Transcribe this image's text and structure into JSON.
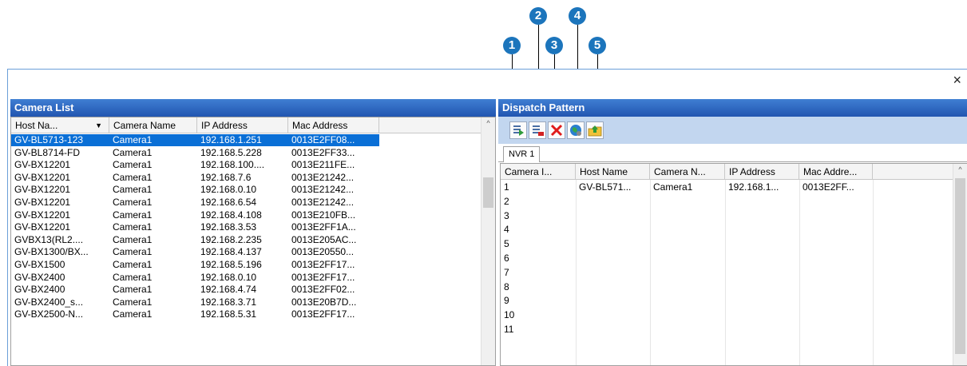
{
  "callouts": [
    "1",
    "2",
    "3",
    "4",
    "5"
  ],
  "window": {
    "close_glyph": "×"
  },
  "camera_list": {
    "title": "Camera List",
    "columns": [
      "Host Na...",
      "Camera Name",
      "IP Address",
      "Mac Address"
    ],
    "sort_glyph": "▼",
    "rows": [
      [
        "GV-BL5713-123",
        "Camera1",
        "192.168.1.251",
        "0013E2FF08..."
      ],
      [
        "GV-BL8714-FD",
        "Camera1",
        "192.168.5.228",
        "0013E2FF33..."
      ],
      [
        "GV-BX12201",
        "Camera1",
        "192.168.100....",
        "0013E211FE..."
      ],
      [
        "GV-BX12201",
        "Camera1",
        "192.168.7.6",
        "0013E21242..."
      ],
      [
        "GV-BX12201",
        "Camera1",
        "192.168.0.10",
        "0013E21242..."
      ],
      [
        "GV-BX12201",
        "Camera1",
        "192.168.6.54",
        "0013E21242..."
      ],
      [
        "GV-BX12201",
        "Camera1",
        "192.168.4.108",
        "0013E210FB..."
      ],
      [
        "GV-BX12201",
        "Camera1",
        "192.168.3.53",
        "0013E2FF1A..."
      ],
      [
        "GVBX13(RL2....",
        "Camera1",
        "192.168.2.235",
        "0013E205AC..."
      ],
      [
        "GV-BX1300/BX...",
        "Camera1",
        "192.168.4.137",
        "0013E20550..."
      ],
      [
        "GV-BX1500",
        "Camera1",
        "192.168.5.196",
        "0013E2FF17..."
      ],
      [
        "GV-BX2400",
        "Camera1",
        "192.168.0.10",
        "0013E2FF17..."
      ],
      [
        "GV-BX2400",
        "Camera1",
        "192.168.4.74",
        "0013E2FF02..."
      ],
      [
        "GV-BX2400_s...",
        "Camera1",
        "192.168.3.71",
        "0013E20B7D..."
      ],
      [
        "GV-BX2500-N...",
        "Camera1",
        "192.168.5.31",
        "0013E2FF17..."
      ]
    ],
    "selected_row": 0,
    "scroll_up_glyph": "^"
  },
  "dispatch_pattern": {
    "title": "Dispatch Pattern",
    "toolbar": [
      "add-camera-icon",
      "remove-camera-icon",
      "delete-icon",
      "network-globe-icon",
      "export-folder-icon"
    ],
    "tab": "NVR 1",
    "columns": [
      "Camera I...",
      "Host Name",
      "Camera N...",
      "IP Address",
      "Mac Addre..."
    ],
    "rows": [
      [
        "1",
        "GV-BL571...",
        "Camera1",
        "192.168.1...",
        "0013E2FF..."
      ],
      [
        "2",
        "",
        "",
        "",
        ""
      ],
      [
        "3",
        "",
        "",
        "",
        ""
      ],
      [
        "4",
        "",
        "",
        "",
        ""
      ],
      [
        "5",
        "",
        "",
        "",
        ""
      ],
      [
        "6",
        "",
        "",
        "",
        ""
      ],
      [
        "7",
        "",
        "",
        "",
        ""
      ],
      [
        "8",
        "",
        "",
        "",
        ""
      ],
      [
        "9",
        "",
        "",
        "",
        ""
      ],
      [
        "10",
        "",
        "",
        "",
        ""
      ],
      [
        "11",
        "",
        "",
        "",
        ""
      ]
    ],
    "scroll_up_glyph": "^",
    "colors": {
      "add": "#2e9b3a",
      "remove": "#d22323",
      "delete": "#e01b1b",
      "globe": "#2a7fd0",
      "folder": "#f0c23a"
    }
  }
}
